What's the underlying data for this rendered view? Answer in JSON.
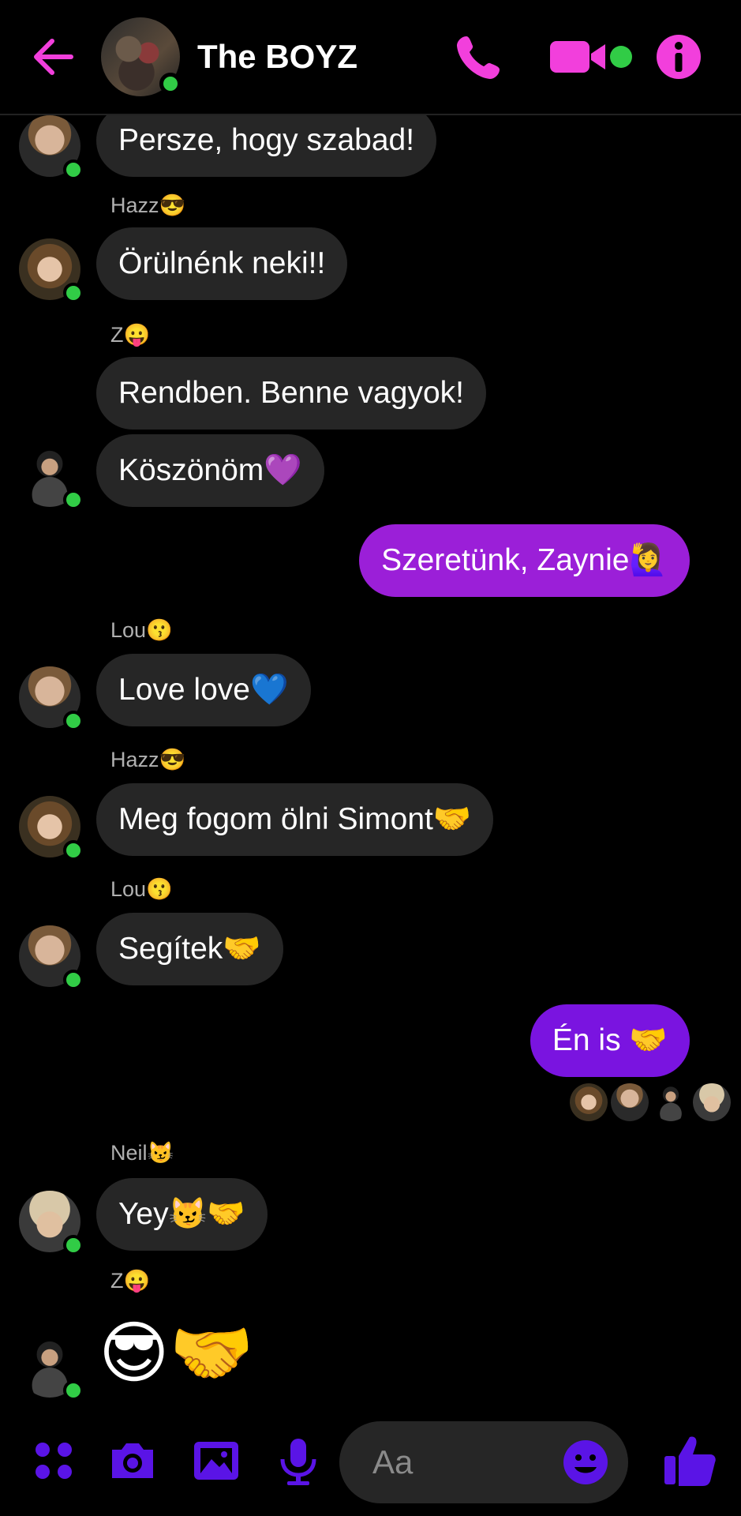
{
  "header": {
    "title": "The BOYZ",
    "icons": [
      "back-arrow-icon",
      "phone-icon",
      "video-camera-icon",
      "info-icon"
    ],
    "accent_color": "#f23fdc"
  },
  "messages": [
    {
      "sender": "",
      "text": "Persze, hogy szabad!",
      "avatar": "lou"
    },
    {
      "sender": "Hazz😎",
      "text": "Örülnénk neki!!",
      "avatar": "hazz"
    },
    {
      "sender": "Z😛",
      "text": "Rendben. Benne vagyok!",
      "avatar": ""
    },
    {
      "sender": "",
      "text": "Köszönöm💜",
      "avatar": "zayn"
    },
    {
      "sender": "",
      "text": "Szeretünk, Zaynie🙋‍♀️",
      "outgoing": true
    },
    {
      "sender": "Lou😗",
      "text": "Love love💙",
      "avatar": "lou"
    },
    {
      "sender": "Hazz😎",
      "text": "Meg fogom ölni Simont🤝",
      "avatar": "hazz"
    },
    {
      "sender": "Lou😗",
      "text": "Segítek🤝",
      "avatar": "lou"
    },
    {
      "sender": "",
      "text": "Én is 🤝",
      "outgoing": true
    },
    {
      "sender": "Neil😼",
      "text": "Yey😼🤝",
      "avatar": "neil"
    },
    {
      "sender": "Z😛",
      "text": "😎🤝",
      "avatar": "zayn",
      "big": true
    }
  ],
  "composer": {
    "placeholder": "Aa",
    "icons": [
      "menu-dots-icon",
      "camera-icon",
      "gallery-icon",
      "microphone-icon",
      "emoji-icon",
      "thumbs-up-icon"
    ],
    "accent_color": "#5a14e6"
  }
}
